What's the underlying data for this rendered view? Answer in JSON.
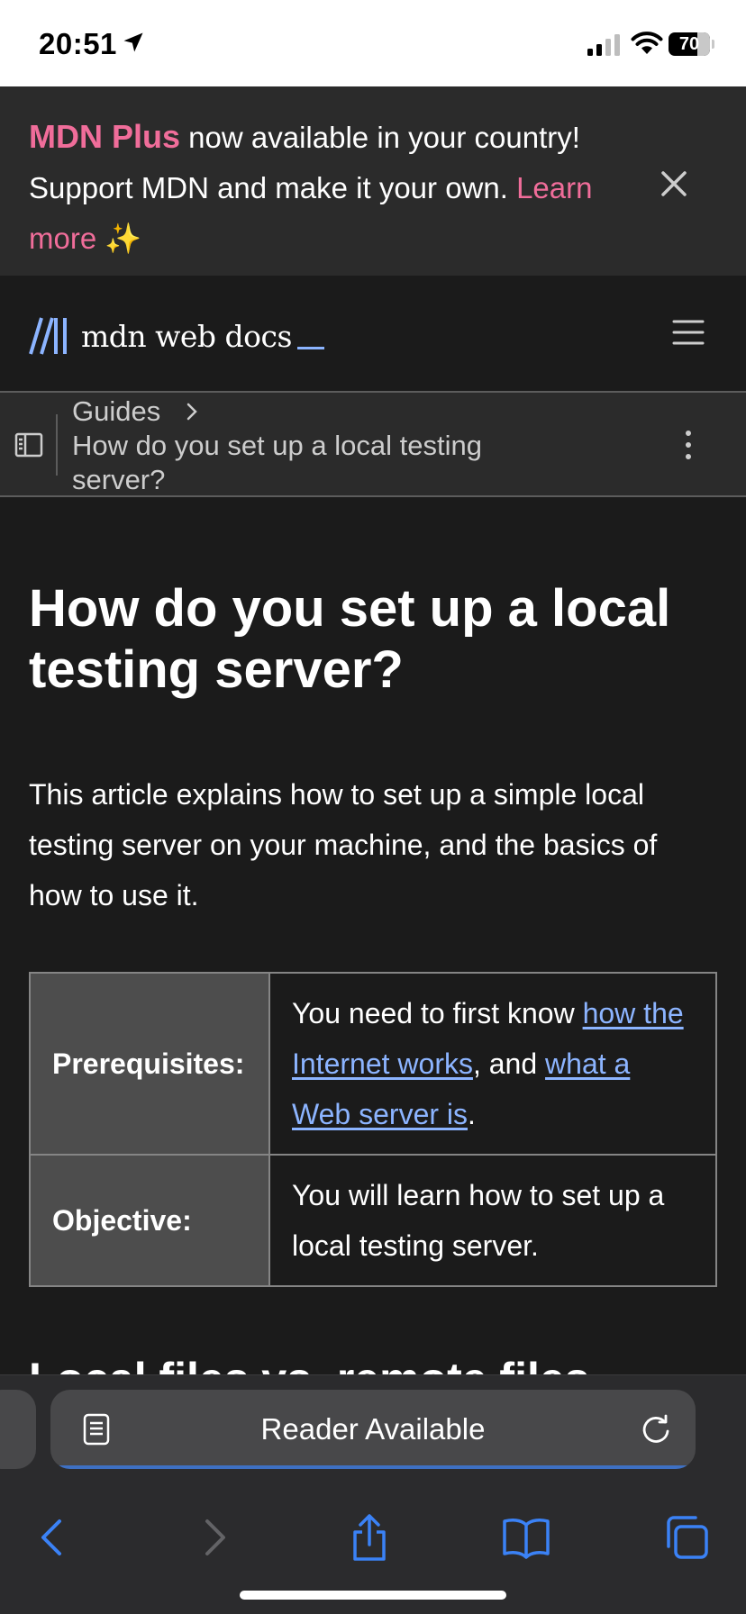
{
  "status_bar": {
    "time": "20:51",
    "battery": "70",
    "icons": [
      "location-arrow-icon",
      "cellular-signal-icon",
      "wifi-icon",
      "battery-icon"
    ]
  },
  "banner": {
    "brand": "MDN Plus",
    "text_1": " now available in your country! Support MDN and make it your own. ",
    "link": "Learn more",
    "sparkle": "✨",
    "close_icon": "close-icon",
    "brand_color": "#f06d9a"
  },
  "header": {
    "logo_text": "mdn web docs",
    "menu_icon": "hamburger-menu-icon"
  },
  "breadcrumb": {
    "parent": "Guides",
    "current": "How do you set up a local testing server?",
    "sidebar_icon": "sidebar-toggle-icon",
    "more_icon": "more-vertical-icon"
  },
  "article": {
    "title": "How do you set up a local testing server?",
    "intro": "This article explains how to set up a simple local testing server on your machine, and the basics of how to use it.",
    "table": {
      "prereq_label": "Prerequisites:",
      "prereq_text_1": "You need to first know ",
      "prereq_link_1": "how the Internet works",
      "prereq_text_2": ", and ",
      "prereq_link_2": "what a Web server is",
      "prereq_text_3": ".",
      "objective_label": "Objective:",
      "objective_text": "You will learn how to set up a local testing server."
    },
    "next_heading": "Local files vs. remote files",
    "link_color": "#8cb4ff"
  },
  "safari": {
    "address_text": "Reader Available",
    "icons": [
      "reader-icon",
      "reload-icon",
      "back-icon",
      "forward-icon",
      "share-icon",
      "bookmarks-icon",
      "tabs-icon"
    ],
    "accent_color": "#3b82f6"
  }
}
